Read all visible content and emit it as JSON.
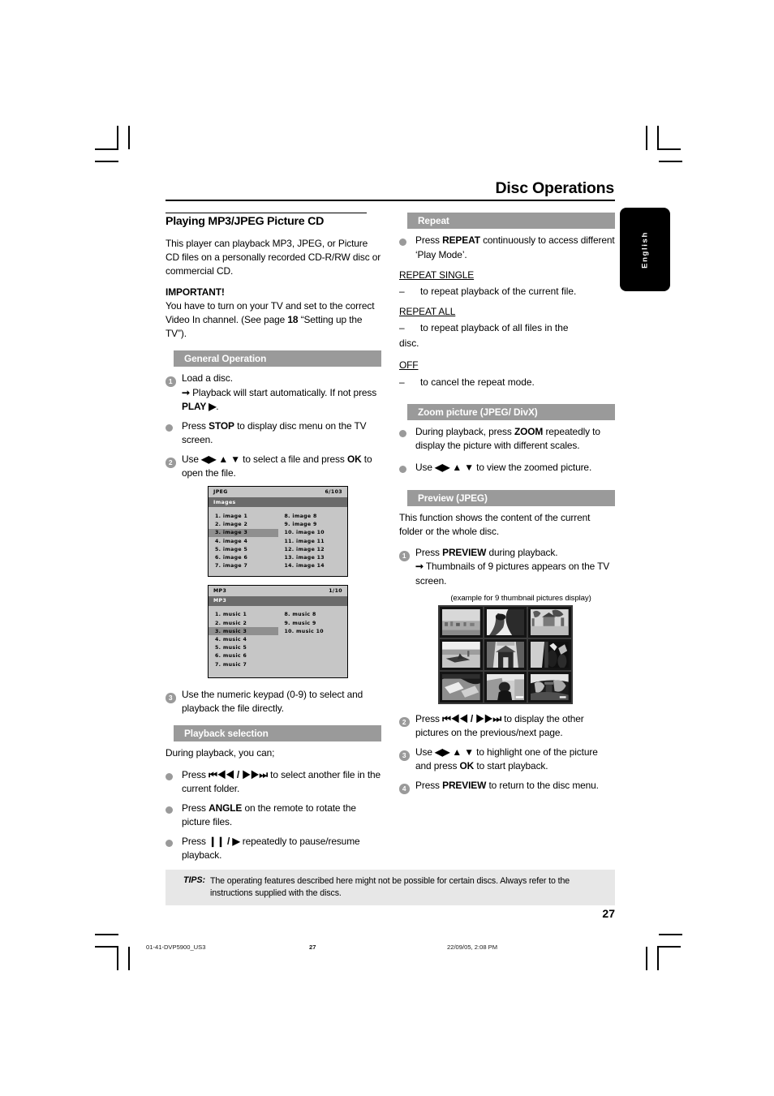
{
  "running_head": "Disc Operations",
  "language_tab": "English",
  "page_number": "27",
  "left_column": {
    "section_title": "Playing MP3/JPEG Picture CD",
    "intro": "This player can playback MP3, JPEG, or Picture CD files on a personally recorded CD-R/RW disc or commercial CD.",
    "important_label": "IMPORTANT!",
    "important_text_1": "You have to turn on your TV and set to the correct Video In channel.  (See page ",
    "important_page": "18",
    "important_text_2": " “Setting up the TV”).",
    "general_operation": {
      "bar": "General Operation",
      "step1_num": "1",
      "step1_text": "Load a disc.",
      "step1_arrow_1": "Playback will start automatically. If not press ",
      "step1_arrow_bold": "PLAY ▶",
      "step1_arrow_2": ".",
      "bullet1_pre": "Press ",
      "bullet1_bold": "STOP",
      "bullet1_post": " to display disc menu on the TV screen.",
      "step2_num": "2",
      "step2_pre": "Use ",
      "step2_keys": "◀▶ ▲ ▼",
      "step2_mid": " to select a file and press ",
      "step2_bold": "OK",
      "step2_post": " to open the file.",
      "step3_num": "3",
      "step3_text": "Use the numeric keypad (0-9) to select and playback the file directly."
    },
    "jpeg_osd": {
      "type": "JPEG",
      "counter": "6/103",
      "folder": "Images",
      "col1": [
        "1. image 1",
        "2. image 2",
        "3. image 3",
        "4. image 4",
        "5. image 5",
        "6. image 6",
        "7. image 7"
      ],
      "col2": [
        "8. image 8",
        "9. image 9",
        "10. image 10",
        "11. image 11",
        "12. image 12",
        "13. image 13",
        "14. image 14"
      ],
      "selected": "3. image 3"
    },
    "mp3_osd": {
      "type": "MP3",
      "counter": "1/10",
      "folder": "MP3",
      "col1": [
        "1. music 1",
        "2. music 2",
        "3. music 3",
        "4. music 4",
        "5. music 5",
        "6. music 6",
        "7. music 7"
      ],
      "col2": [
        "8. music 8",
        "9. music 9",
        "10. music 10"
      ],
      "selected": "3. music 3"
    },
    "playback_selection": {
      "bar": "Playback selection",
      "intro": "During playback, you can;",
      "b1_pre": "Press ",
      "b1_keys": "⏮◀◀ / ▶▶⏭",
      "b1_post": " to select another file in the current folder.",
      "b2_pre": "Press ",
      "b2_bold": "ANGLE",
      "b2_post": " on the remote to rotate the picture files.",
      "b3_pre": "Press ",
      "b3_keys": "❙❙ / ▶",
      "b3_post": " repeatedly to pause/resume playback."
    }
  },
  "right_column": {
    "repeat": {
      "bar": "Repeat",
      "b1_pre": "Press ",
      "b1_bold": "REPEAT",
      "b1_post": " continuously to access different ‘Play Mode’.",
      "modes": [
        {
          "name": "REPEAT SINGLE",
          "desc": "to repeat playback of the current file.",
          "tail": ""
        },
        {
          "name": "REPEAT ALL",
          "desc": "to repeat playback of all files in the",
          "tail": "disc."
        },
        {
          "name": "OFF",
          "desc": "to cancel the repeat mode.",
          "tail": ""
        }
      ]
    },
    "zoom": {
      "bar": "Zoom picture (JPEG/ DivX)",
      "b1_pre": "During playback, press ",
      "b1_bold": "ZOOM",
      "b1_post": " repeatedly to display the picture with different scales.",
      "b2_pre": "Use ",
      "b2_keys": "◀▶ ▲ ▼",
      "b2_post": " to view the zoomed picture."
    },
    "preview": {
      "bar": "Preview (JPEG)",
      "intro": "This function shows the content of the current folder or the whole disc.",
      "step1_num": "1",
      "step1_pre": "Press ",
      "step1_bold": "PREVIEW",
      "step1_post": " during playback.",
      "step1_arrow": "Thumbnails of 9 pictures appears on the TV screen.",
      "example_caption": "(example for 9 thumbnail pictures display)",
      "step2_num": "2",
      "step2_pre": "Press ",
      "step2_keys": "⏮◀◀ / ▶▶⏭",
      "step2_post": " to display the other pictures on the previous/next page.",
      "step3_num": "3",
      "step3_pre": "Use ",
      "step3_keys": "◀▶ ▲ ▼",
      "step3_mid": " to highlight one of the picture and press ",
      "step3_bold": "OK",
      "step3_post": " to start playback.",
      "step4_num": "4",
      "step4_pre": "Press ",
      "step4_bold": "PREVIEW",
      "step4_post": " to return to the disc menu."
    }
  },
  "tips": {
    "label": "TIPS:",
    "text": "The operating features described here might not be possible for certain discs.  Always refer to the instructions supplied with the discs."
  },
  "printer_slug": {
    "file": "01-41-DVP5900_US3",
    "page": "27",
    "timestamp": "22/09/05, 2:08 PM"
  },
  "colors": {
    "bar_gray": "#9a9a9a",
    "osd_bg": "#c6c6c6",
    "osd_folder": "#6b6b6b",
    "osd_select": "#8f8f8f",
    "tips_bg": "#e7e7e7",
    "tab_black": "#000000"
  }
}
